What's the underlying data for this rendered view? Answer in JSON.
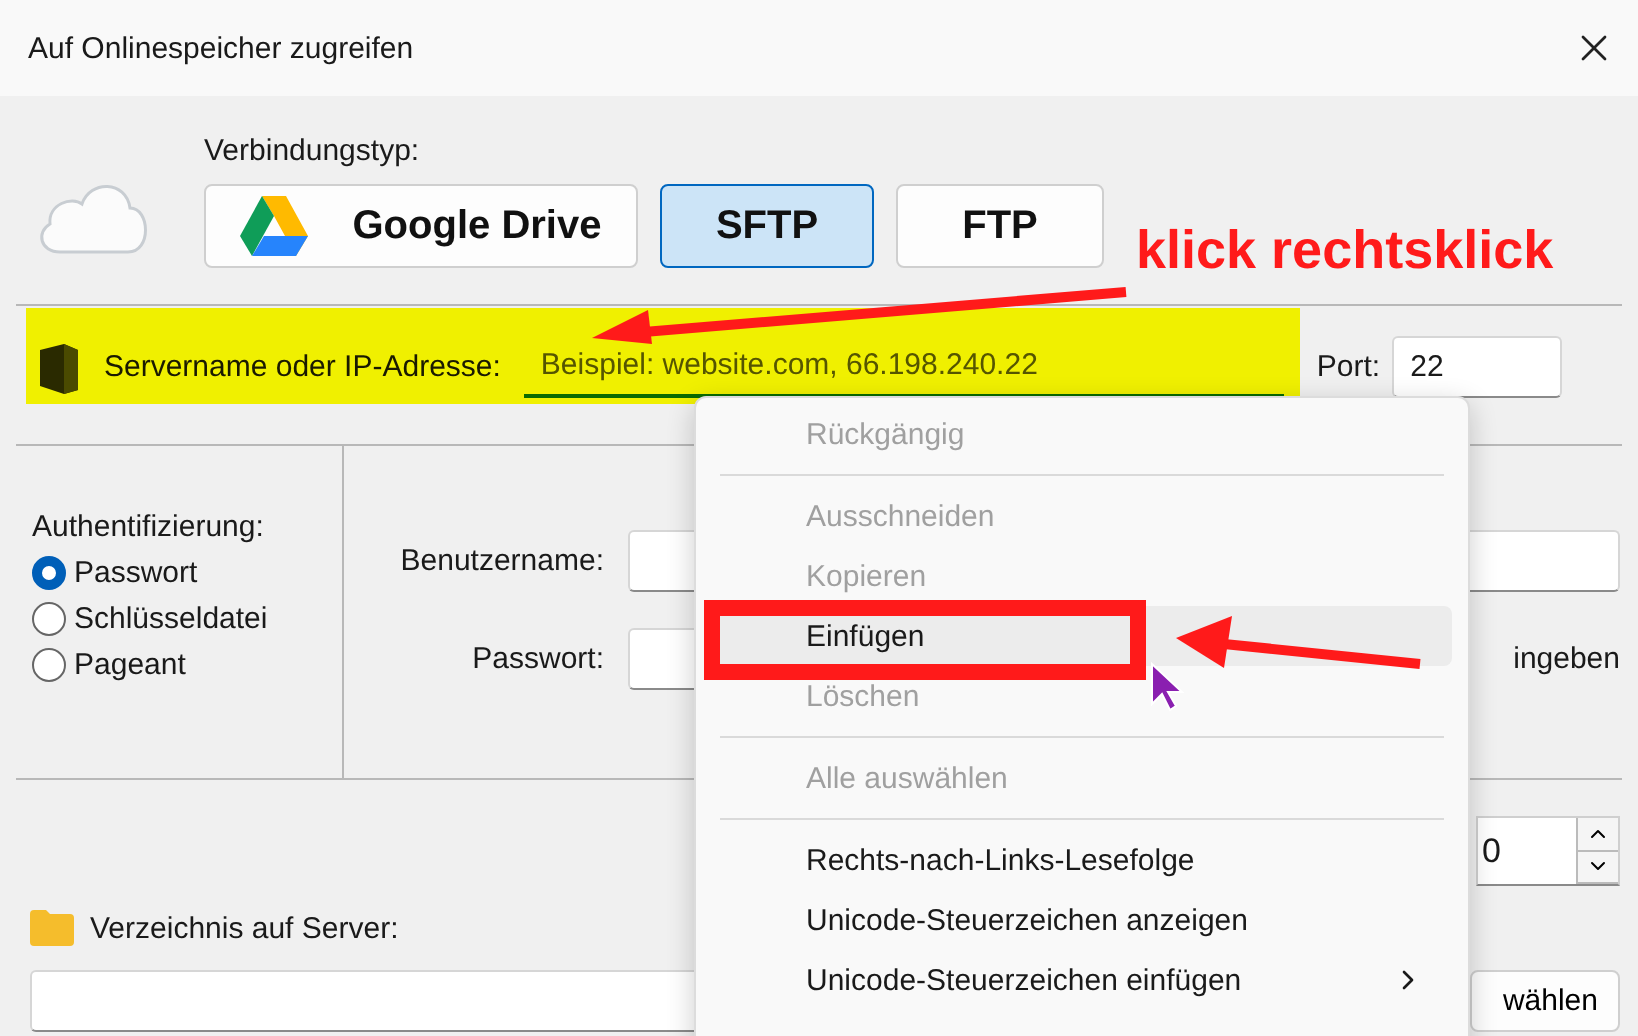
{
  "window": {
    "title": "Auf Onlinespeicher zugreifen"
  },
  "connection": {
    "label": "Verbindungstyp:",
    "types": [
      {
        "label": "Google Drive",
        "kind": "drive",
        "selected": false
      },
      {
        "label": "SFTP",
        "kind": "plain",
        "selected": true
      },
      {
        "label": "FTP",
        "kind": "plain",
        "selected": false
      }
    ]
  },
  "server": {
    "label": "Servername oder IP-Adresse:",
    "value": "Beispiel: website.com, 66.198.240.22",
    "port_label": "Port:",
    "port_value": "22"
  },
  "auth": {
    "label": "Authentifizierung:",
    "options": [
      {
        "label": "Passwort",
        "selected": true
      },
      {
        "label": "Schlüsseldatei",
        "selected": false
      },
      {
        "label": "Pageant",
        "selected": false
      }
    ],
    "username_label": "Benutzername:",
    "password_label": "Passwort:",
    "password_hint": "ingeben"
  },
  "spinner": {
    "value": "0"
  },
  "directory": {
    "label": "Verzeichnis auf Server:",
    "button": "wählen"
  },
  "context_menu": {
    "items": [
      {
        "kind": "item",
        "label": "Rückgängig",
        "disabled": true,
        "highlighted": false,
        "submenu": false
      },
      {
        "kind": "separator"
      },
      {
        "kind": "item",
        "label": "Ausschneiden",
        "disabled": true,
        "highlighted": false,
        "submenu": false
      },
      {
        "kind": "item",
        "label": "Kopieren",
        "disabled": true,
        "highlighted": false,
        "submenu": false
      },
      {
        "kind": "item",
        "label": "Einfügen",
        "disabled": false,
        "highlighted": true,
        "submenu": false
      },
      {
        "kind": "item",
        "label": "Löschen",
        "disabled": true,
        "highlighted": false,
        "submenu": false
      },
      {
        "kind": "separator"
      },
      {
        "kind": "item",
        "label": "Alle auswählen",
        "disabled": true,
        "highlighted": false,
        "submenu": false
      },
      {
        "kind": "separator"
      },
      {
        "kind": "item",
        "label": "Rechts-nach-Links-Lesefolge",
        "disabled": false,
        "highlighted": false,
        "submenu": false
      },
      {
        "kind": "item",
        "label": "Unicode-Steuerzeichen anzeigen",
        "disabled": false,
        "highlighted": false,
        "submenu": false
      },
      {
        "kind": "item",
        "label": "Unicode-Steuerzeichen einfügen",
        "disabled": false,
        "highlighted": false,
        "submenu": true
      }
    ]
  },
  "annotation": {
    "callout": "klick rechtsklick"
  }
}
